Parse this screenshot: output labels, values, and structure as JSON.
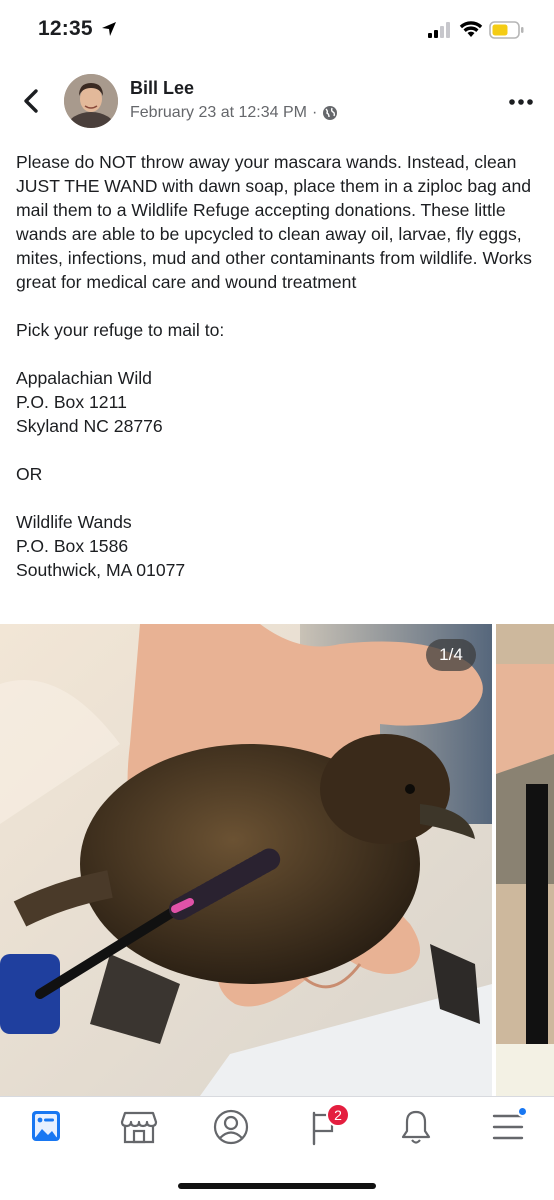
{
  "status_bar": {
    "time": "12:35"
  },
  "post": {
    "author": "Bill Lee",
    "timestamp": "February 23 at 12:34 PM",
    "separator": "·",
    "privacy_icon": "globe-icon",
    "paragraph1": "Please do NOT throw away your mascara wands. Instead, clean JUST THE WAND with dawn soap, place them in a ziploc bag and mail them to a Wildlife Refuge accepting donations. These little wands are able to be upcycled to clean away oil, larvae, fly eggs, mites, infections, mud and other contaminants from wildlife. Works great for medical care and wound treatment",
    "paragraph2": "Pick your refuge to mail to:",
    "address1": [
      "Appalachian Wild",
      "P.O. Box 1211",
      "Skyland NC 28776"
    ],
    "or_text": "OR",
    "address2": [
      "Wildlife Wands",
      "P.O. Box 1586",
      "Southwick, MA 01077"
    ]
  },
  "carousel": {
    "counter": "1/4"
  },
  "tabbar": {
    "items": [
      {
        "name": "news-feed",
        "icon": "news-feed-icon",
        "active": true
      },
      {
        "name": "marketplace",
        "icon": "storefront-icon"
      },
      {
        "name": "profile",
        "icon": "profile-icon"
      },
      {
        "name": "pages",
        "icon": "flag-icon",
        "badge": "2"
      },
      {
        "name": "notifications",
        "icon": "bell-icon"
      },
      {
        "name": "menu",
        "icon": "menu-icon",
        "dot": true
      }
    ]
  },
  "colors": {
    "accent": "#1877f2",
    "badge": "#e41e3f",
    "secondary_text": "#65676b"
  }
}
